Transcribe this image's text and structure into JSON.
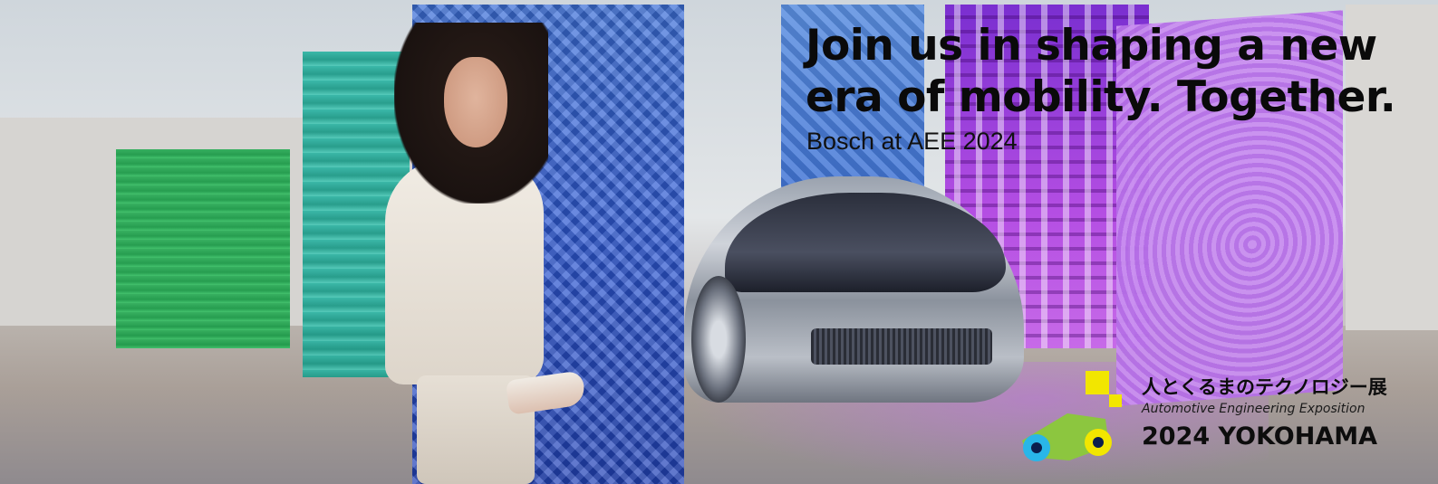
{
  "banner": {
    "headline_line1": "Join us in shaping a new",
    "headline_line2": "era of mobility. Together.",
    "subline": "Bosch at AEE 2024"
  },
  "logo": {
    "name": "Automotive Engineering Exposition logo",
    "jp_title": "人とくるまのテクノロジー展",
    "en_title": "Automotive Engineering Exposition",
    "year_city": "2024 YOKOHAMA",
    "colors": {
      "yellow": "#f2e600",
      "green": "#8cc63f",
      "cyan": "#29b6e8",
      "navy": "#0b1f4d"
    }
  },
  "scene": {
    "icons": [
      "woman-figure",
      "concept-car",
      "glass-panel-green",
      "glass-panel-teal",
      "glass-panel-blue",
      "glass-panel-violet",
      "glass-panel-lilac"
    ]
  }
}
